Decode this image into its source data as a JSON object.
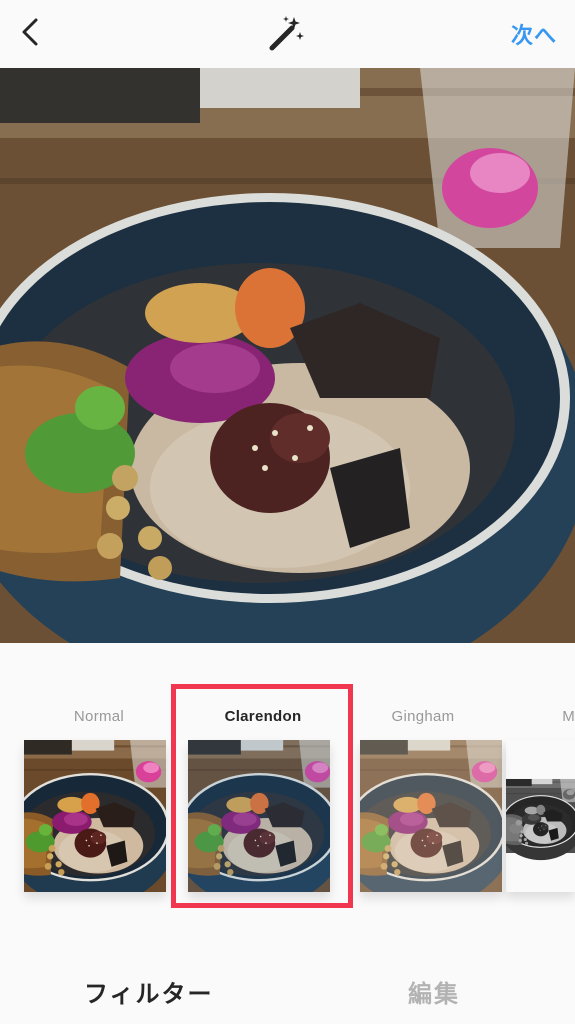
{
  "header": {
    "back_icon": "chevron-left-icon",
    "lux_icon": "magic-wand-icon",
    "next_label": "次へ",
    "accent_color": "#3897f0"
  },
  "filters": [
    {
      "name": "Normal",
      "selected": false
    },
    {
      "name": "Clarendon",
      "selected": true
    },
    {
      "name": "Gingham",
      "selected": false
    },
    {
      "name": "M",
      "selected": false
    }
  ],
  "highlight_color": "#f0374f",
  "tabs": {
    "filter_label": "フィルター",
    "edit_label": "編集",
    "active": "filter"
  }
}
